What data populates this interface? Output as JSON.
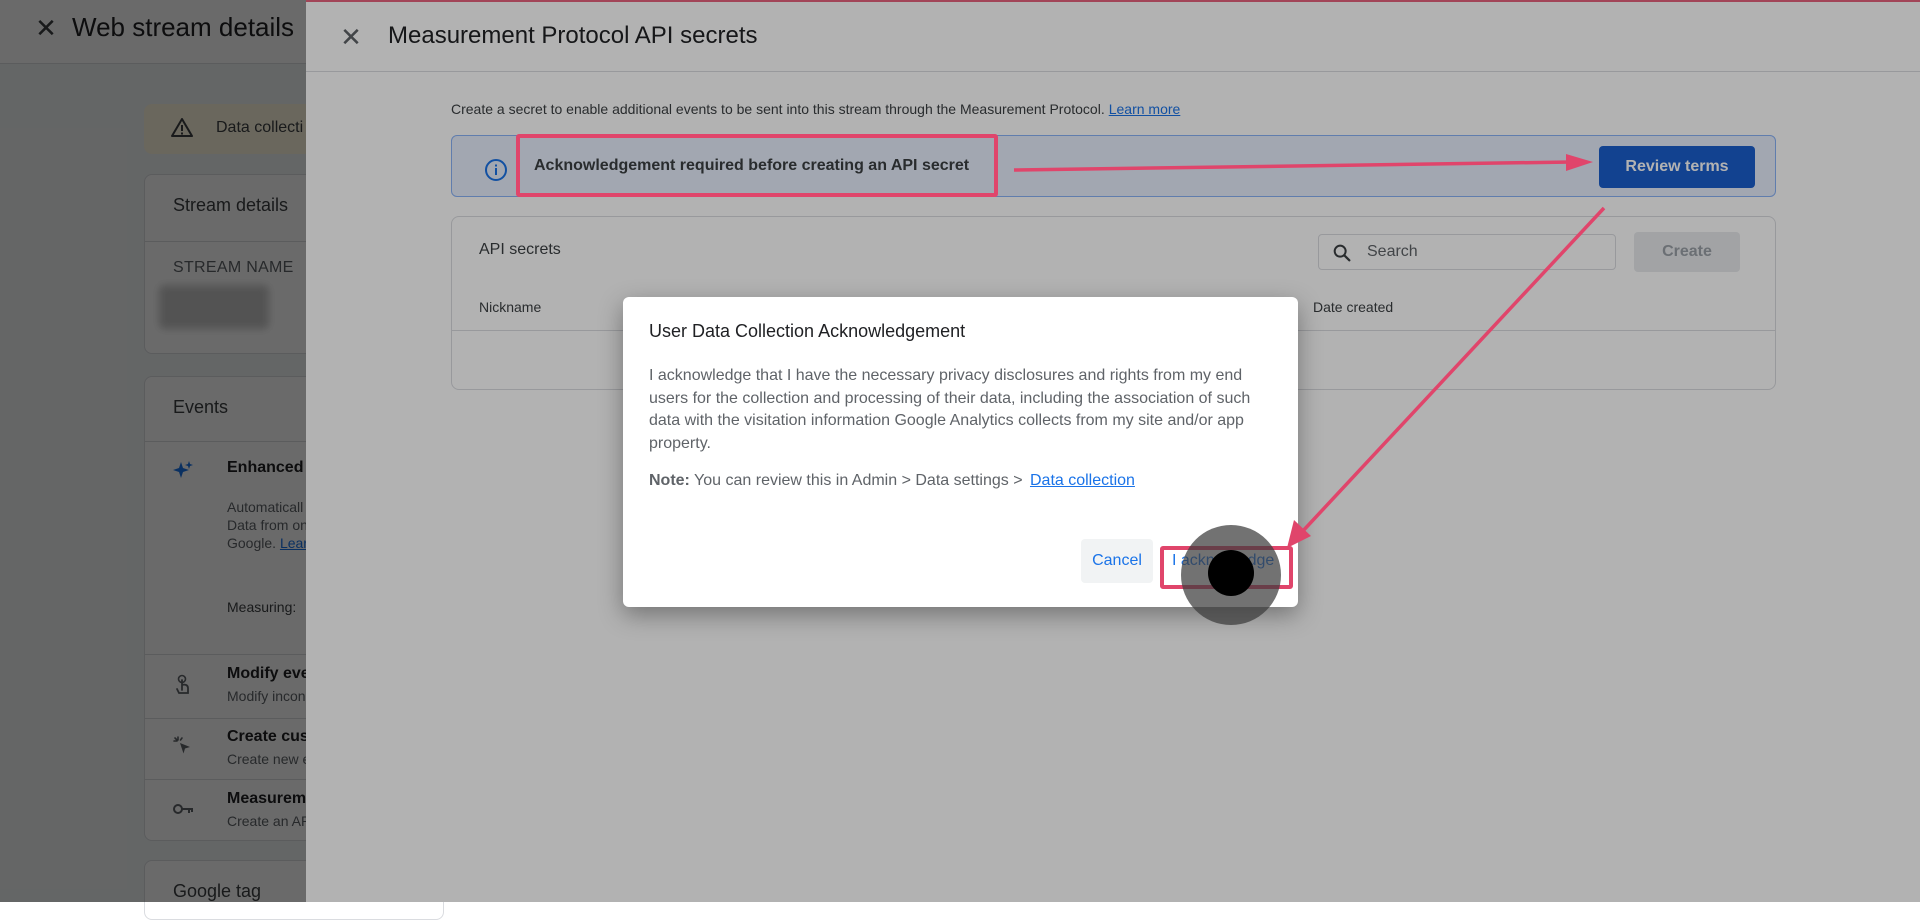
{
  "background": {
    "title": "Web stream details",
    "alert_text": "Data collecti",
    "stream_card_title": "Stream details",
    "stream_name_label": "STREAM NAME",
    "events_title": "Events",
    "events": [
      {
        "title": "Enhanced r",
        "lines": [
          "Automaticall",
          "Data from on"
        ],
        "last_line": "Google. ",
        "link": "Lear"
      },
      {
        "measuring_label": "Measuring:"
      },
      {
        "title": "Modify eve",
        "sub": "Modify incon"
      },
      {
        "title": "Create cust",
        "sub": "Create new e"
      },
      {
        "title": "Measureme",
        "sub": "Create an AP"
      }
    ],
    "google_tag_title": "Google tag"
  },
  "panel": {
    "title": "Measurement Protocol API secrets",
    "description": "Create a secret to enable additional events to be sent into this stream through the Measurement Protocol.",
    "learn_more": "Learn more",
    "ack_banner_text": "Acknowledgement required before creating an API secret",
    "review_terms_label": "Review terms",
    "secrets_title": "API secrets",
    "search_placeholder": "Search",
    "create_label": "Create",
    "columns": {
      "nickname": "Nickname",
      "date_created": "Date created"
    }
  },
  "modal": {
    "title": "User Data Collection Acknowledgement",
    "body": "I acknowledge that I have the necessary privacy disclosures and rights from my end users for the collection and processing of their data, including the association of such data with the visitation information Google Analytics collects from my site and/or app property.",
    "note_label": "Note:",
    "note_text": " You can review this in Admin > Data settings > ",
    "note_link": "Data collection",
    "cancel_label": "Cancel",
    "acknowledge_label": "I acknowledge"
  },
  "colors": {
    "accent_blue": "#1a73e8",
    "button_blue": "#1a5fcf",
    "annotation_pink": "#e0456b",
    "banner_bg": "#e8f0fe",
    "warning_bg": "#fef7e0"
  },
  "icons": [
    "close-icon",
    "warning-icon",
    "sparkle-icon",
    "touch-icon",
    "cursor-click-icon",
    "key-icon",
    "info-icon",
    "search-icon",
    "mouse-pointer-icon"
  ]
}
